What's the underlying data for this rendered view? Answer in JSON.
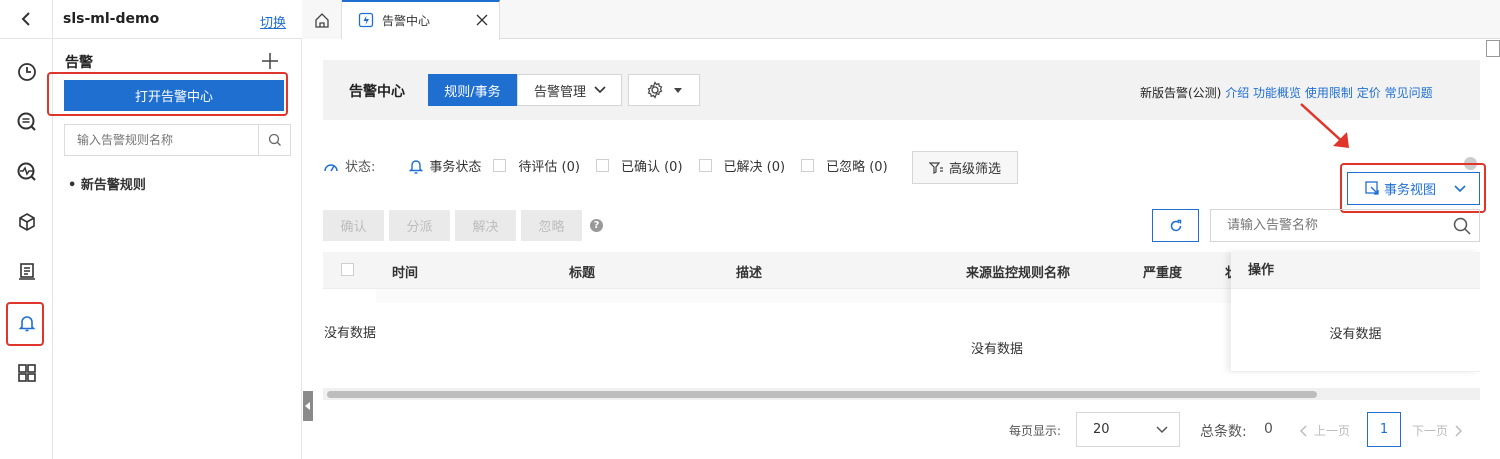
{
  "project": {
    "back_icon": "chevron-left-icon",
    "name": "sls-ml-demo",
    "switch_label": "切换"
  },
  "rail": {
    "items": [
      {
        "name": "clock-icon"
      },
      {
        "name": "query-icon"
      },
      {
        "name": "monitor-icon"
      },
      {
        "name": "cube-icon"
      },
      {
        "name": "report-icon"
      },
      {
        "name": "bell-icon",
        "active": true
      },
      {
        "name": "grid-icon"
      }
    ]
  },
  "panel": {
    "title": "告警",
    "add_icon": "plus-icon",
    "open_center_label": "打开告警中心",
    "search_placeholder": "输入告警规则名称",
    "tree_item": "新告警规则"
  },
  "tabs": {
    "home_icon": "home-icon",
    "active_tab_label": "告警中心",
    "close_icon": "close-icon"
  },
  "header": {
    "title": "告警中心",
    "tab_rules": "规则/事务",
    "tab_manage": "告警管理",
    "settings_icon": "gear-icon",
    "right_label": "新版告警(公测)",
    "links": [
      "介绍",
      "功能概览",
      "使用限制",
      "定价",
      "常见问题"
    ]
  },
  "filters": {
    "status_label": "状态:",
    "event_status_label": "事务状态",
    "options": [
      "待评估 (0)",
      "已确认 (0)",
      "已解决 (0)",
      "已忽略 (0)"
    ],
    "advanced_label": "高级筛选",
    "view_label": "事务视图"
  },
  "actions": {
    "buttons": [
      "确认",
      "分派",
      "解决",
      "忽略"
    ],
    "search_placeholder": "请输入告警名称"
  },
  "table": {
    "columns": [
      "时间",
      "标题",
      "描述",
      "来源监控规则名称",
      "严重度",
      "状",
      "操作"
    ],
    "empty_left": "没有数据",
    "empty_center": "没有数据",
    "empty_right": "没有数据"
  },
  "pagination": {
    "page_size_label": "每页显示:",
    "page_size": "20",
    "total_label": "总条数:",
    "total": "0",
    "prev": "上一页",
    "page": "1",
    "next": "下一页"
  },
  "colors": {
    "primary": "#1f6fd1",
    "highlight": "#e0352b"
  }
}
